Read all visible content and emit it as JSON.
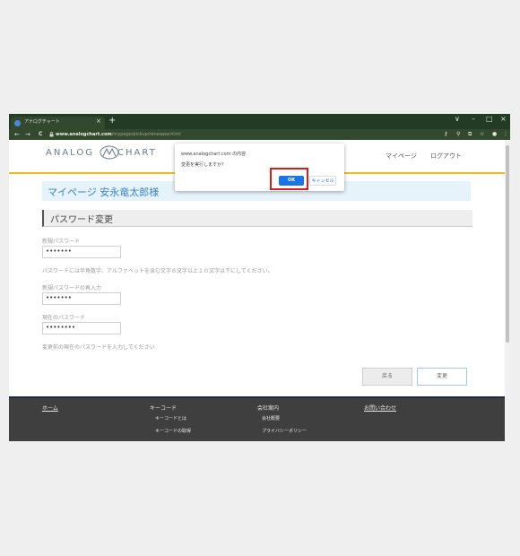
{
  "browser": {
    "tab_title": "アナログチャート",
    "tab_close": "×",
    "new_tab": "+",
    "window_controls": {
      "tabs_menu": "∨",
      "minimize": "–",
      "maximize": "□",
      "close": "×"
    },
    "nav": {
      "back": "←",
      "forward": "→",
      "reload": "C"
    },
    "url": {
      "domain": "www.analogchart.com",
      "path": "/mypage/pickup/renewpw.html"
    },
    "toolbar_icons": [
      "key-icon",
      "zoom-icon",
      "share-icon",
      "star-icon",
      "profile-icon",
      "menu-icon"
    ]
  },
  "header": {
    "logo_left": "ANALOG",
    "logo_right": "CHART",
    "nav_mypage": "マイページ",
    "nav_logout": "ログアウト"
  },
  "content": {
    "mypage_title": "マイページ 安永竜太郎様",
    "section_title": "パスワード変更",
    "new_pw_label": "新規パスワード",
    "new_pw_value": "•••••••",
    "pw_hint": "パスワードには半角数字、アルファベットを含む文字６文字以上１０文字以下にしてください。",
    "confirm_pw_label": "新規パスワードの再入力",
    "confirm_pw_value": "•••••••",
    "current_pw_label": "現在のパスワード",
    "current_pw_value": "••••••••",
    "current_pw_hint": "変更前の現在のパスワードを入力してください",
    "back_button": "戻る",
    "change_button": "変更"
  },
  "footer": {
    "home": "ホーム",
    "keycode": "キーコード",
    "keycode_about": "キーコードとは",
    "keycode_get": "キーコードの取得",
    "company": "会社案内",
    "company_overview": "会社概要",
    "privacy": "プライバシーポリシー",
    "contact": "お問い合わせ"
  },
  "dialog": {
    "title": "www.analogchart.com の内容",
    "message": "変更を実行しますか？",
    "ok": "OK",
    "cancel": "キャンセル"
  },
  "colors": {
    "titlebar": "#233a25",
    "accent_blue": "#1a73e8",
    "highlight_red": "#d41e1e",
    "header_rule": "#e7bb2e",
    "title_blue": "#3a84c7"
  }
}
